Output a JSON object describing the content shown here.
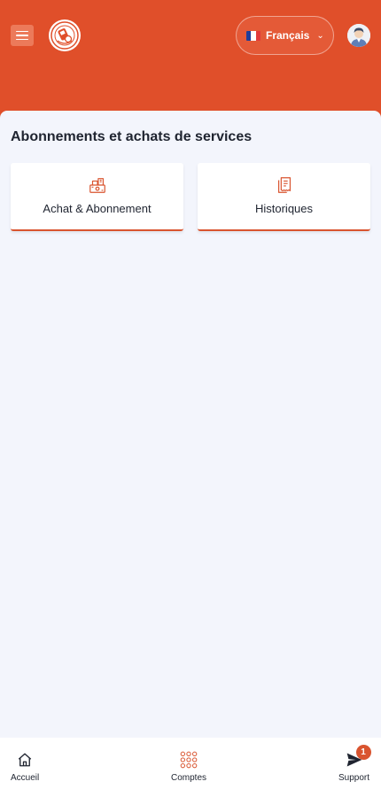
{
  "header": {
    "language": {
      "label": "Français",
      "flag_colors": [
        "#1f3d99",
        "#ffffff",
        "#e23b3b"
      ]
    }
  },
  "colors": {
    "brand": "#e04f2a",
    "accent": "#d9542f",
    "background": "#f3f5fc"
  },
  "main": {
    "section_title": "Abonnements et achats de services",
    "cards": [
      {
        "label": "Achat & Abonnement",
        "icon": "cash-register-icon"
      },
      {
        "label": "Historiques",
        "icon": "receipt-icon"
      }
    ]
  },
  "bottom_nav": {
    "items": [
      {
        "label": "Accueil",
        "icon": "home-icon"
      },
      {
        "label": "Comptes",
        "icon": "grid-icon"
      },
      {
        "label": "Support",
        "icon": "send-icon",
        "badge": "1"
      }
    ]
  }
}
